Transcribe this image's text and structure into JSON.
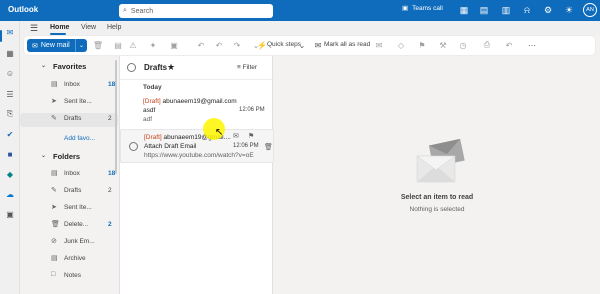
{
  "app": {
    "title": "Outlook"
  },
  "search": {
    "placeholder": "Search"
  },
  "titlebar": {
    "teams_call": "Teams call",
    "avatar_initials": "AN"
  },
  "menu": {
    "tabs": [
      "Home",
      "View",
      "Help"
    ]
  },
  "ribbon": {
    "new_mail": "New mail",
    "quick_steps": "Quick steps",
    "mark_all_read": "Mark all as read"
  },
  "folders": {
    "favorites_label": "Favorites",
    "favorites": [
      {
        "label": "Inbox",
        "count": "18",
        "icon": "inbox-icon"
      },
      {
        "label": "Sent Ite...",
        "count": "",
        "icon": "sent-icon"
      },
      {
        "label": "Drafts",
        "count": "2",
        "icon": "draft-icon"
      }
    ],
    "add_favorite": "Add favo...",
    "folders_label": "Folders",
    "items": [
      {
        "label": "Inbox",
        "count": "18"
      },
      {
        "label": "Drafts",
        "count": "2"
      },
      {
        "label": "Sent Ite...",
        "count": ""
      },
      {
        "label": "Delete...",
        "count": "2"
      },
      {
        "label": "Junk Em...",
        "count": ""
      },
      {
        "label": "Archive",
        "count": ""
      },
      {
        "label": "Notes",
        "count": ""
      }
    ]
  },
  "list": {
    "title": "Drafts",
    "filter": "Filter",
    "group": "Today",
    "messages": [
      {
        "draft_tag": "[Draft]",
        "sender": "abunaeem19@gmail.com",
        "subject": "asdf",
        "preview": "adf",
        "time": "12:06 PM"
      },
      {
        "draft_tag": "[Draft]",
        "sender": "abunaeem19@gmail....",
        "subject": "Attach Draft Email",
        "preview": "https://www.youtube.com/watch?v=oE...",
        "time": "12:06 PM"
      }
    ]
  },
  "reading": {
    "title": "Select an item to read",
    "subtitle": "Nothing is selected"
  },
  "colors": {
    "brand": "#0f6cbd",
    "draft_tag": "#c4441a"
  }
}
